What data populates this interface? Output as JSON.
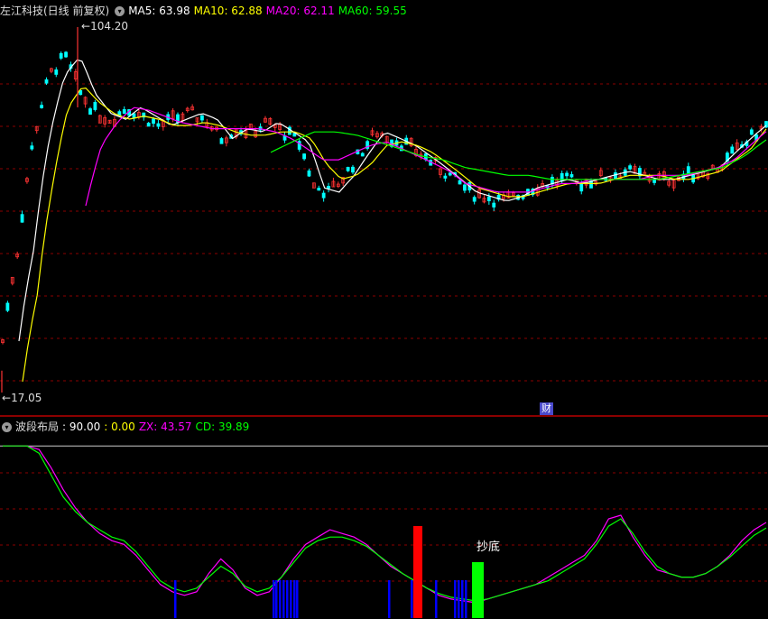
{
  "colors": {
    "ma5": "#ffffff",
    "ma10": "#ffff00",
    "ma20": "#ff00ff",
    "ma60": "#00ff00",
    "up": "#ff3333",
    "down": "#00ffff",
    "grid": "#8b0000",
    "zx": "#ff00ff",
    "cd": "#00ff00",
    "buy_bar": "#ff0000",
    "bottom_bar": "#00ff00",
    "signal_bar": "#0000ff",
    "label": "#ffffff"
  },
  "main_panel": {
    "title": "左江科技(日线 前复权)",
    "collapse_icon": "chevron-down-icon",
    "ma5_label": "MA5: 63.98",
    "ma10_label": "MA10: 62.88",
    "ma20_label": "MA20: 62.11",
    "ma60_label": "MA60: 59.55",
    "high_marker": "104.20",
    "low_marker": "17.05",
    "finance_marker": "财"
  },
  "sub_panel": {
    "title": "波段布局",
    "value_90": ": 90.00",
    "value_0": ": 0.00",
    "zx_label": "ZX: 43.57",
    "cd_label": "CD: 39.89",
    "annotation": "抄底"
  },
  "chart_data": [
    {
      "type": "line",
      "title": "左江科技(日线 前复权)",
      "ylim": [
        17.05,
        104.2
      ],
      "scale": "log",
      "bars": 158,
      "series": [
        {
          "name": "MA5",
          "values": [
            22,
            35,
            60,
            82,
            90,
            75,
            68,
            66,
            70,
            67,
            64,
            66,
            68,
            66,
            60,
            63,
            62,
            65,
            62,
            59,
            47,
            46,
            50,
            56,
            62,
            60,
            58,
            55,
            52,
            49,
            46,
            45,
            44,
            45,
            47,
            48,
            49,
            48,
            49,
            50,
            51,
            50,
            49,
            49,
            50,
            51,
            52,
            56,
            60,
            64
          ]
        },
        {
          "name": "MA10",
          "values": [
            18,
            28,
            48,
            70,
            78,
            72,
            68,
            66,
            67,
            66,
            64,
            64,
            65,
            64,
            62,
            61,
            61,
            62,
            62,
            60,
            53,
            49,
            50,
            53,
            58,
            59,
            58,
            56,
            53,
            50,
            47,
            46,
            45,
            45,
            46,
            47,
            48,
            48,
            48,
            49,
            50,
            50,
            50,
            49,
            49,
            50,
            51,
            54,
            57,
            62.9
          ]
        },
        {
          "name": "MA20",
          "values": [
            43,
            58,
            65,
            70,
            69,
            67,
            65,
            64,
            63,
            63,
            63,
            63,
            62,
            60,
            57,
            54,
            54,
            56,
            58,
            59,
            57,
            55,
            53,
            51,
            48,
            47,
            46,
            46,
            46,
            47,
            48,
            48,
            49,
            49,
            49,
            49,
            50,
            50,
            50,
            51,
            52,
            54,
            58,
            62.1
          ]
        },
        {
          "name": "MA60",
          "values": [
            56,
            59,
            62,
            62,
            61,
            59,
            57,
            55,
            54,
            52,
            51,
            50,
            50,
            49,
            49,
            49,
            49,
            49,
            49,
            50,
            51,
            52,
            55,
            59.6
          ]
        }
      ],
      "annotations": [
        "104.20",
        "17.05",
        "财"
      ]
    },
    {
      "type": "line",
      "title": "波段布局",
      "ylim": [
        0,
        100
      ],
      "reference_lines": [
        90,
        0
      ],
      "series": [
        {
          "name": "ZX",
          "values": [
            90,
            90,
            90,
            88,
            78,
            66,
            56,
            48,
            42,
            38,
            36,
            30,
            22,
            14,
            10,
            8,
            10,
            20,
            28,
            22,
            12,
            8,
            10,
            18,
            28,
            36,
            40,
            44,
            42,
            40,
            36,
            30,
            24,
            20,
            16,
            12,
            8,
            6,
            5,
            4,
            6,
            8,
            10,
            12,
            14,
            18,
            22,
            26,
            30,
            38,
            50,
            52,
            40,
            30,
            22,
            20,
            18,
            18,
            20,
            24,
            30,
            38,
            44,
            48
          ]
        },
        {
          "name": "CD",
          "values": [
            90,
            90,
            90,
            86,
            74,
            62,
            54,
            48,
            44,
            40,
            38,
            32,
            24,
            16,
            12,
            10,
            12,
            18,
            24,
            20,
            13,
            10,
            12,
            18,
            26,
            34,
            38,
            40,
            40,
            38,
            35,
            30,
            25,
            20,
            16,
            12,
            9,
            7,
            6,
            5,
            6,
            8,
            10,
            12,
            14,
            16,
            20,
            24,
            28,
            36,
            46,
            50,
            42,
            32,
            24,
            20,
            18,
            18,
            20,
            24,
            29,
            35,
            41,
            45
          ]
        }
      ],
      "annotations": [
        "抄底"
      ]
    }
  ]
}
